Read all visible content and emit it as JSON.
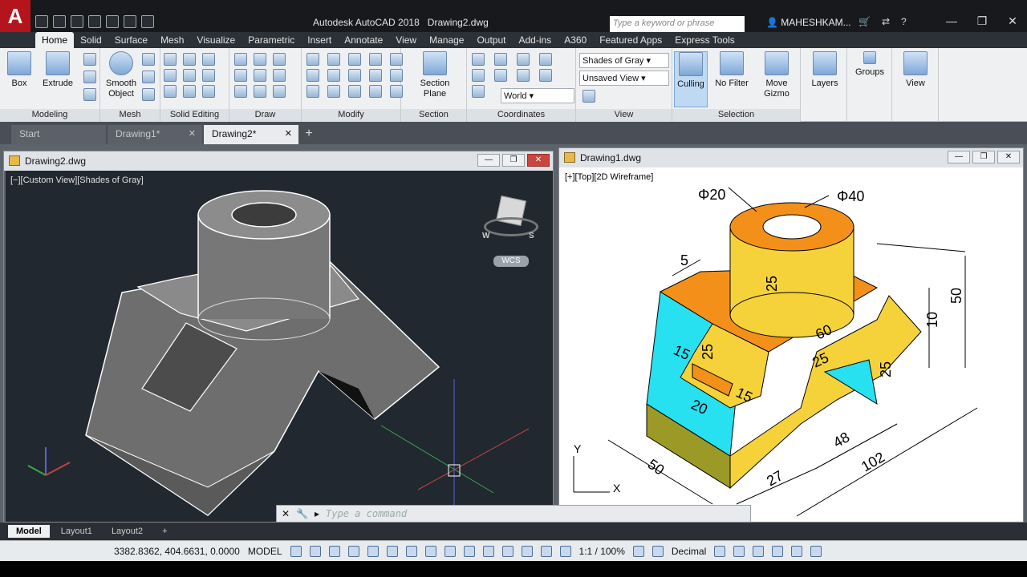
{
  "app": {
    "logo": "A",
    "title": "Autodesk AutoCAD 2018",
    "document": "Drawing2.dwg"
  },
  "search": {
    "placeholder": "Type a keyword or phrase"
  },
  "user": {
    "name": "MAHESHKAM..."
  },
  "ribbon_tabs": [
    "Home",
    "Solid",
    "Surface",
    "Mesh",
    "Visualize",
    "Parametric",
    "Insert",
    "Annotate",
    "View",
    "Manage",
    "Output",
    "Add-ins",
    "A360",
    "Featured Apps",
    "Express Tools"
  ],
  "ribbon": {
    "box": "Box",
    "extrude": "Extrude",
    "smooth_object": "Smooth Object",
    "section_plane": "Section Plane",
    "visual_style": "Shades of Gray",
    "saved_view": "Unsaved View",
    "ucs": "World",
    "culling": "Culling",
    "no_filter": "No Filter",
    "move_gizmo": "Move Gizmo",
    "layers": "Layers",
    "groups": "Groups",
    "view": "View",
    "panels": {
      "modeling": "Modeling",
      "mesh": "Mesh",
      "solid_editing": "Solid Editing",
      "draw": "Draw",
      "modify": "Modify",
      "section": "Section",
      "coordinates": "Coordinates",
      "view": "View",
      "selection": "Selection"
    }
  },
  "doc_tabs": {
    "start": "Start",
    "drawing1": "Drawing1*",
    "drawing2": "Drawing2*"
  },
  "viewports": {
    "left": {
      "title": "Drawing2.dwg",
      "label": "[−][Custom View][Shades of Gray]",
      "wcs": "WCS",
      "cube_compass": [
        "W",
        "S"
      ]
    },
    "right": {
      "title": "Drawing1.dwg",
      "label": "[+][Top][2D Wireframe]",
      "dims": {
        "d1": "Φ20",
        "d2": "Φ40",
        "d3": "5",
        "d4": "25",
        "d5": "50",
        "d6": "10",
        "d7": "60",
        "d8": "25",
        "d9": "25",
        "d10": "25",
        "d11": "15",
        "d12": "15",
        "d13": "20",
        "d14": "50",
        "d15": "27",
        "d16": "48",
        "d17": "102"
      },
      "ucs_y": "Y",
      "ucs_x": "X"
    }
  },
  "command": {
    "placeholder": "Type a command"
  },
  "layout_tabs": [
    "Model",
    "Layout1",
    "Layout2"
  ],
  "status": {
    "coords": "3382.8362, 404.6631, 0.0000",
    "space": "MODEL",
    "scale": "1:1 / 100%",
    "units": "Decimal"
  },
  "colors": {
    "yellow": "#f5d23a",
    "orange": "#f39019",
    "cyan": "#27e0f0",
    "olive": "#9c9a26"
  }
}
